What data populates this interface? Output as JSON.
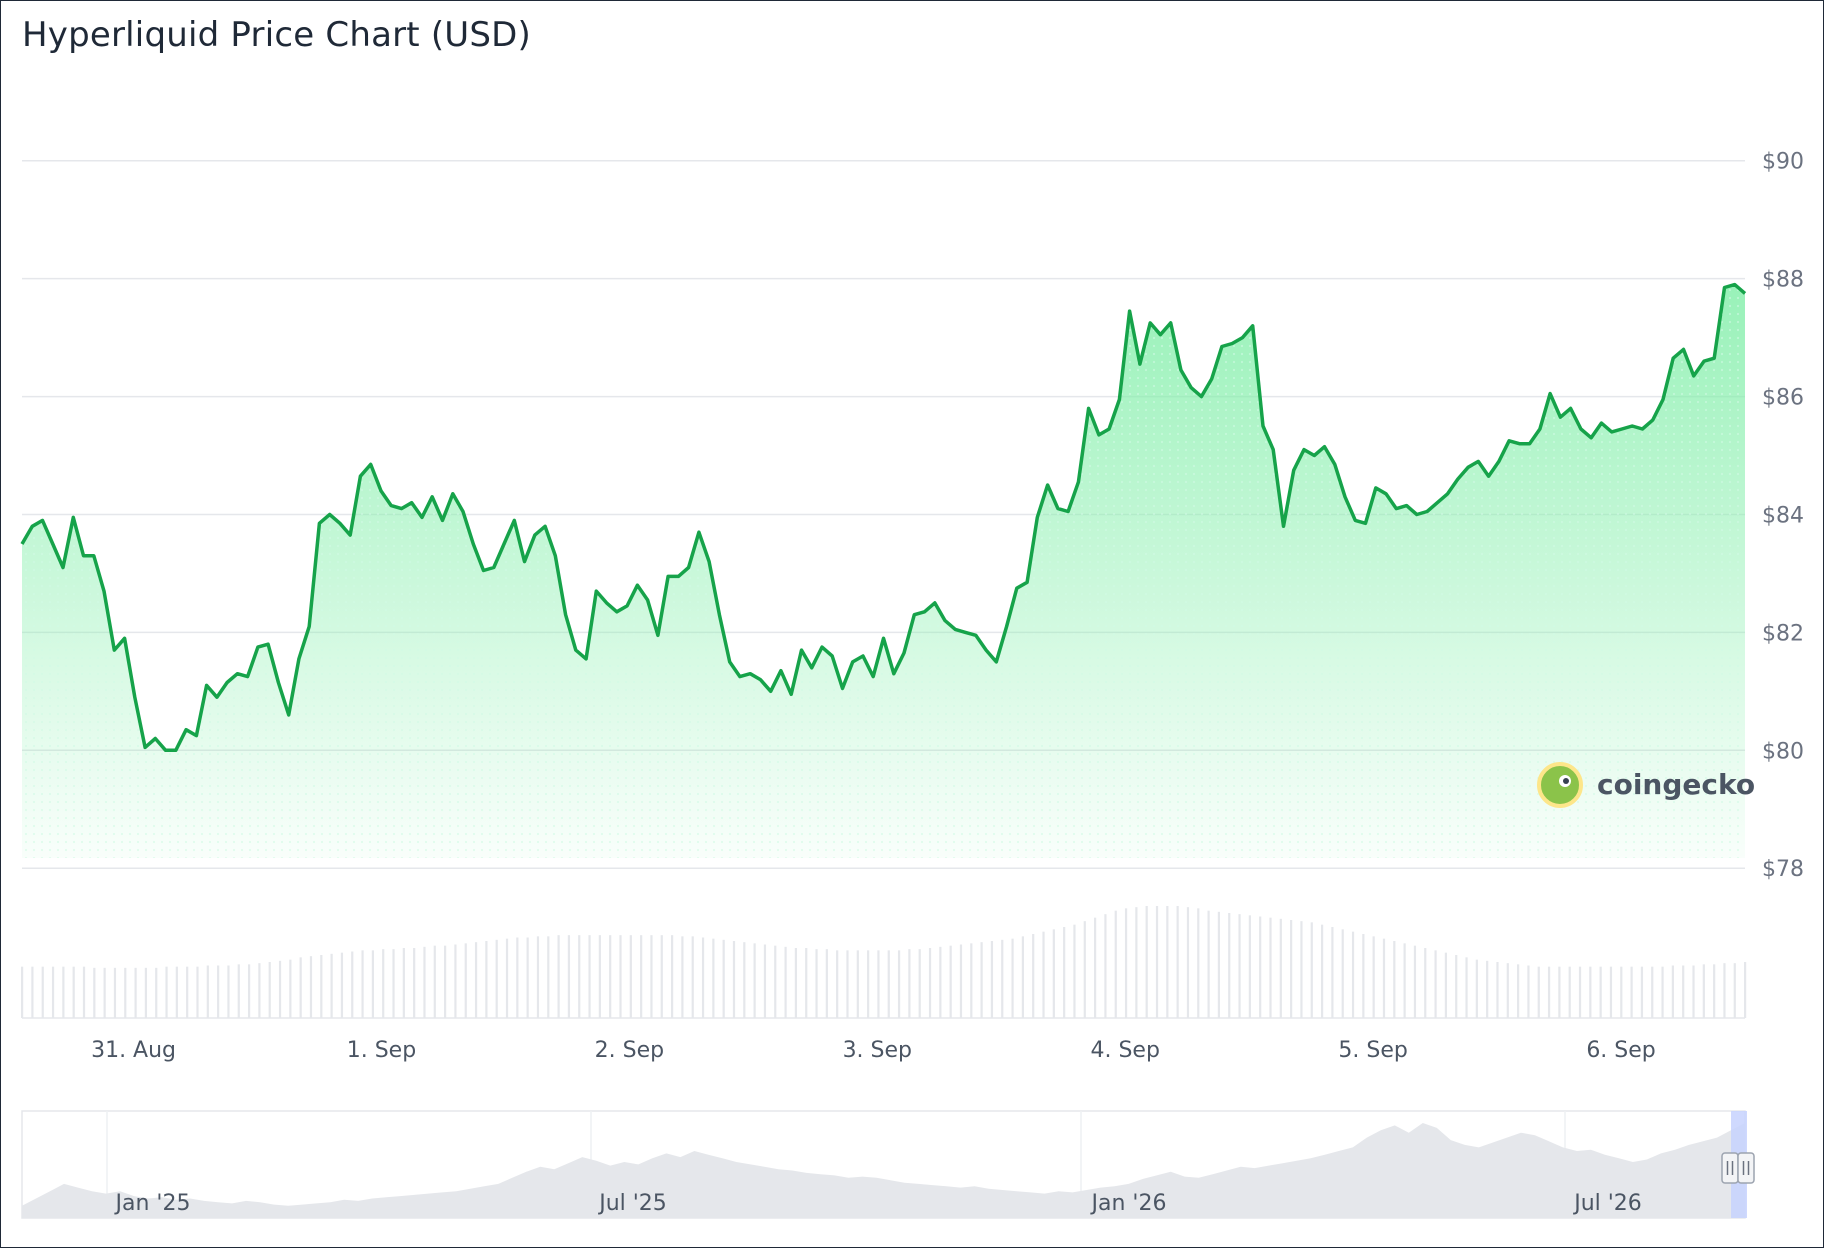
{
  "title": "Hyperliquid Price Chart (USD)",
  "brand": {
    "name": "coingecko",
    "logo_icon": "coingecko-gecko-icon"
  },
  "colors": {
    "line": "#16a34a",
    "area_top": "#86efac",
    "grid": "#e5e7eb",
    "volume": "#e5e7eb",
    "navigator_area": "#e5e7eb",
    "navigator_selection": "#c7d2fe"
  },
  "chart_data": {
    "type": "line",
    "title": "Hyperliquid Price Chart (USD)",
    "xlabel": "",
    "ylabel": "",
    "ylim": [
      77.8,
      91.2
    ],
    "yticks": [
      "$90",
      "$88",
      "$86",
      "$84",
      "$82",
      "$80",
      "$78"
    ],
    "ytick_values": [
      90,
      88,
      86,
      84,
      82,
      80,
      78
    ],
    "x_range_days": [
      30.55,
      37.5
    ],
    "xticks": [
      {
        "label": "31. Aug",
        "day": 31
      },
      {
        "label": "1. Sep",
        "day": 32
      },
      {
        "label": "2. Sep",
        "day": 33
      },
      {
        "label": "3. Sep",
        "day": 34
      },
      {
        "label": "4. Sep",
        "day": 35
      },
      {
        "label": "5. Sep",
        "day": 36
      },
      {
        "label": "6. Sep",
        "day": 37
      }
    ],
    "series": [
      {
        "values": [
          83.5,
          83.8,
          83.9,
          83.5,
          83.1,
          83.95,
          83.3,
          83.3,
          82.7,
          81.7,
          81.9,
          80.9,
          80.05,
          80.2,
          80.0,
          80.0,
          80.35,
          80.25,
          81.1,
          80.9,
          81.15,
          81.3,
          81.25,
          81.75,
          81.8,
          81.15,
          80.6,
          81.55,
          82.1,
          83.85,
          84.0,
          83.85,
          83.65,
          84.65,
          84.85,
          84.4,
          84.15,
          84.1,
          84.2,
          83.95,
          84.3,
          83.9,
          84.35,
          84.05,
          83.5,
          83.05,
          83.1,
          83.5,
          83.9,
          83.2,
          83.65,
          83.8,
          83.3,
          82.3,
          81.7,
          81.55,
          82.7,
          82.5,
          82.35,
          82.45,
          82.8,
          82.55,
          81.95,
          82.95,
          82.95,
          83.1,
          83.7,
          83.2,
          82.3,
          81.5,
          81.25,
          81.3,
          81.2,
          81.0,
          81.35,
          80.95,
          81.7,
          81.4,
          81.75,
          81.6,
          81.05,
          81.5,
          81.6,
          81.25,
          81.9,
          81.3,
          81.65,
          82.3,
          82.35,
          82.5,
          82.2,
          82.05,
          82.0,
          81.95,
          81.7,
          81.5,
          82.1,
          82.75,
          82.85,
          83.95,
          84.5,
          84.1,
          84.05,
          84.55,
          85.8,
          85.35,
          85.45,
          85.95,
          87.45,
          86.55,
          87.25,
          87.05,
          87.25,
          86.45,
          86.15,
          86.0,
          86.3,
          86.85,
          86.9,
          87.0,
          87.2,
          85.5,
          85.1,
          83.8,
          84.75,
          85.1,
          85.0,
          85.15,
          84.85,
          84.3,
          83.9,
          83.85,
          84.45,
          84.35,
          84.1,
          84.15,
          84.0,
          84.05,
          84.2,
          84.35,
          84.6,
          84.8,
          84.9,
          84.65,
          84.9,
          85.25,
          85.2,
          85.2,
          85.45,
          86.05,
          85.65,
          85.8,
          85.45,
          85.3,
          85.55,
          85.4,
          85.45,
          85.5,
          85.45,
          85.6,
          85.95,
          86.65,
          86.8,
          86.35,
          86.6,
          86.65,
          87.85,
          87.9,
          87.75
        ]
      }
    ],
    "volume": {
      "values": [
        44,
        44,
        44,
        44,
        44,
        44,
        44,
        43,
        43,
        43,
        43,
        43,
        43,
        43,
        44,
        44,
        44,
        44,
        45,
        45,
        45,
        46,
        46,
        47,
        48,
        49,
        50,
        52,
        53,
        54,
        55,
        56,
        57,
        58,
        58,
        59,
        59,
        60,
        60,
        61,
        62,
        62,
        63,
        64,
        65,
        66,
        67,
        68,
        69,
        69,
        70,
        70,
        71,
        71,
        71,
        71,
        71,
        71,
        71,
        71,
        71,
        71,
        71,
        71,
        70,
        70,
        69,
        68,
        67,
        66,
        65,
        64,
        63,
        62,
        61,
        60,
        60,
        59,
        59,
        58,
        58,
        58,
        58,
        58,
        58,
        58,
        59,
        59,
        60,
        61,
        62,
        63,
        64,
        65,
        66,
        67,
        68,
        70,
        72,
        74,
        76,
        78,
        80,
        83,
        86,
        89,
        92,
        94,
        95,
        96,
        96,
        96,
        96,
        95,
        94,
        92,
        91,
        90,
        89,
        88,
        87,
        86,
        85,
        84,
        83,
        82,
        80,
        78,
        76,
        74,
        72,
        70,
        68,
        66,
        64,
        62,
        60,
        58,
        56,
        54,
        52,
        50,
        49,
        48,
        47,
        46,
        45,
        44,
        44,
        44,
        44,
        44,
        44,
        44,
        44,
        44,
        44,
        44,
        44,
        44,
        45,
        45,
        45,
        46,
        46,
        47,
        47,
        48
      ]
    },
    "navigator": {
      "xticks": [
        "Jan '25",
        "Jul '25",
        "Jan '26",
        "Jul '26"
      ],
      "values": [
        10,
        16,
        22,
        28,
        25,
        22,
        20,
        22,
        18,
        16,
        17,
        15,
        16,
        14,
        13,
        12,
        14,
        13,
        11,
        10,
        11,
        12,
        13,
        15,
        14,
        16,
        17,
        18,
        19,
        20,
        21,
        22,
        24,
        26,
        28,
        33,
        38,
        42,
        40,
        45,
        50,
        47,
        43,
        46,
        44,
        49,
        53,
        50,
        55,
        52,
        49,
        46,
        44,
        42,
        40,
        39,
        37,
        36,
        35,
        33,
        34,
        33,
        31,
        29,
        28,
        27,
        26,
        25,
        26,
        24,
        23,
        22,
        21,
        20,
        22,
        21,
        23,
        25,
        26,
        28,
        32,
        35,
        38,
        34,
        33,
        36,
        39,
        42,
        41,
        43,
        45,
        47,
        49,
        52,
        55,
        58,
        66,
        72,
        76,
        70,
        78,
        74,
        64,
        60,
        58,
        62,
        66,
        70,
        68,
        63,
        58,
        55,
        56,
        52,
        49,
        46,
        48,
        53,
        56,
        60,
        63,
        66,
        72,
        78
      ]
    }
  }
}
